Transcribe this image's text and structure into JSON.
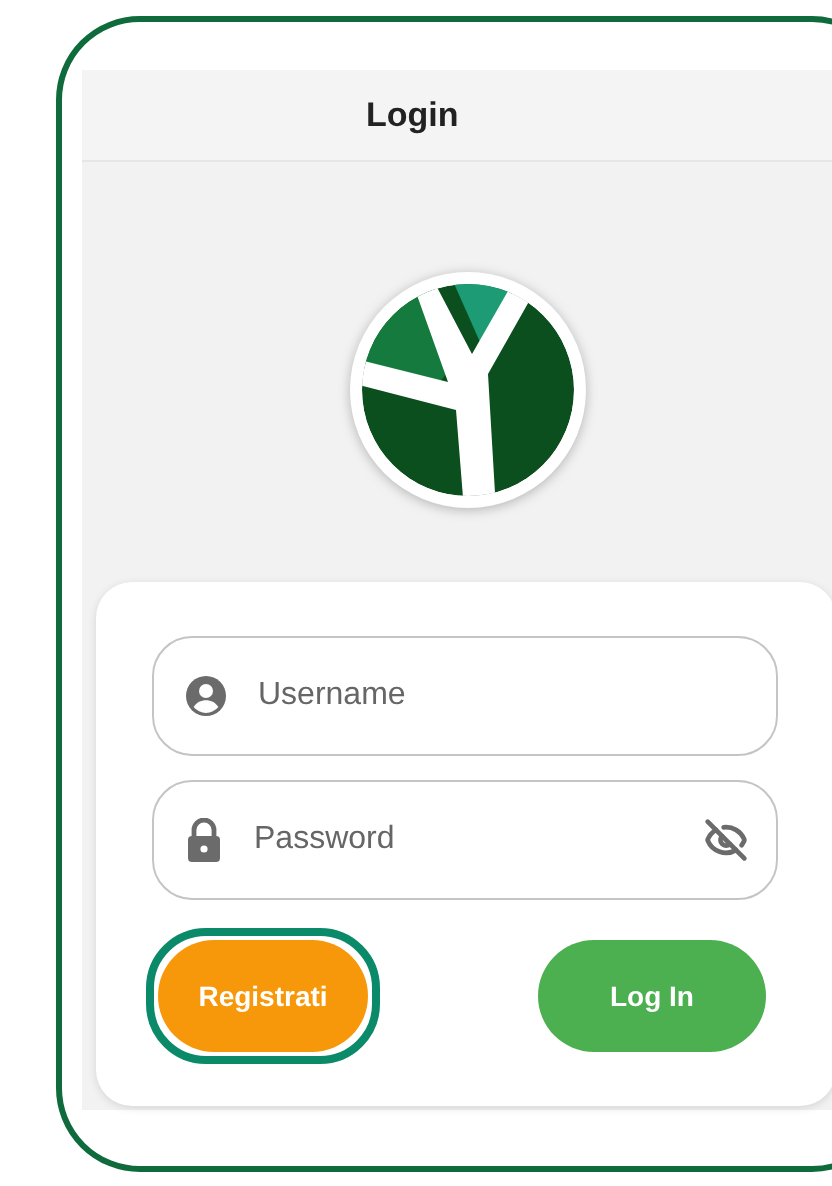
{
  "header": {
    "title": "Login"
  },
  "fields": [
    {
      "kind": "username",
      "placeholder": "Username"
    },
    {
      "kind": "password",
      "placeholder": "Password",
      "password_visible": false
    }
  ],
  "buttons": [
    {
      "kind": "register",
      "label": "Registrati",
      "highlighted": true
    },
    {
      "kind": "login",
      "label": "Log In",
      "highlighted": false
    }
  ]
}
